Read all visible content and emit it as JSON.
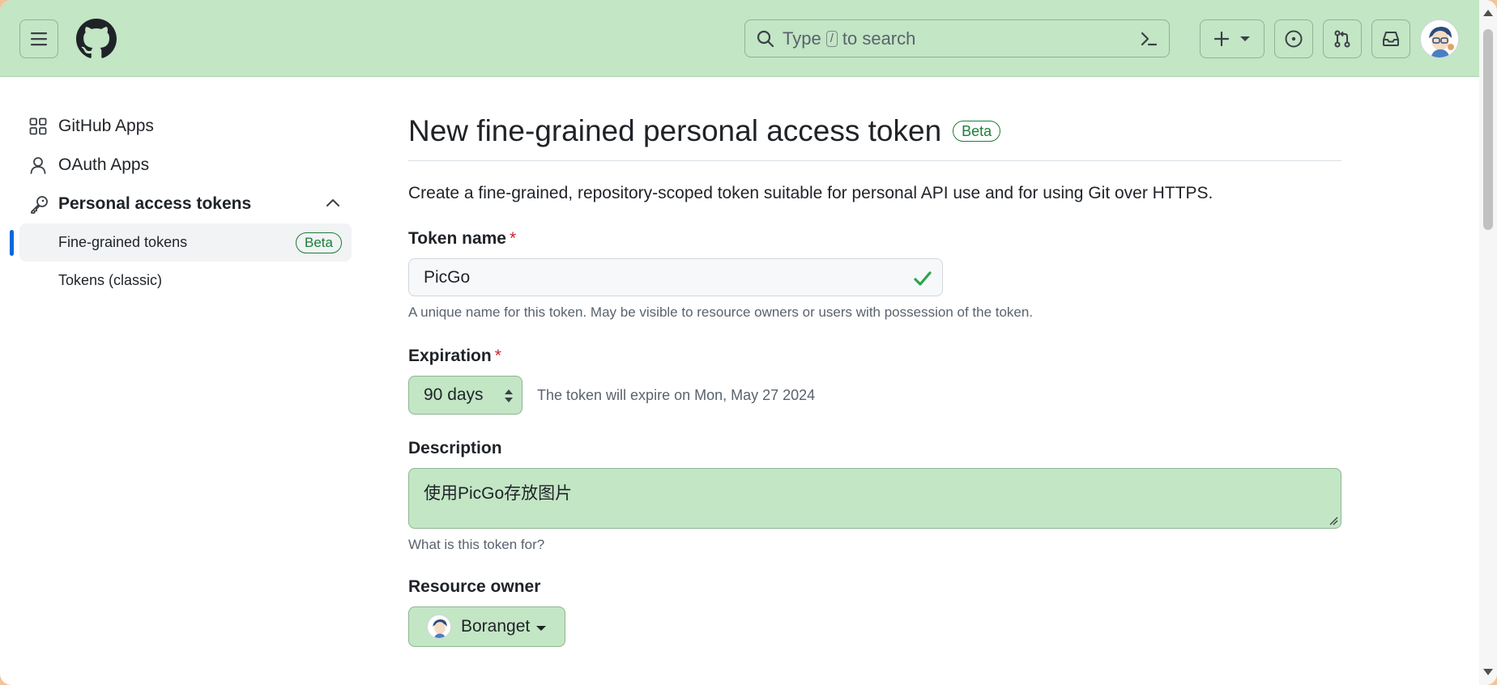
{
  "header": {
    "search_prefix": "Type",
    "search_key": "/",
    "search_suffix": "to search",
    "icons": [
      "menu-icon",
      "github-logo-icon",
      "search-icon",
      "command-palette-icon",
      "plus-icon",
      "chevron-down-icon",
      "issues-icon",
      "pull-request-icon",
      "inbox-icon"
    ]
  },
  "sidebar": {
    "items": [
      {
        "label": "GitHub Apps",
        "icon": "apps-grid-icon"
      },
      {
        "label": "OAuth Apps",
        "icon": "person-icon"
      },
      {
        "label": "Personal access tokens",
        "icon": "key-icon"
      }
    ],
    "sub_items": [
      {
        "label": "Fine-grained tokens",
        "badge": "Beta"
      },
      {
        "label": "Tokens (classic)"
      }
    ]
  },
  "main": {
    "title": "New fine-grained personal access token",
    "title_badge": "Beta",
    "intro": "Create a fine-grained, repository-scoped token suitable for personal API use and for using Git over HTTPS.",
    "token_name": {
      "label": "Token name",
      "required": "*",
      "value": "PicGo",
      "hint": "A unique name for this token. May be visible to resource owners or users with possession of the token."
    },
    "expiration": {
      "label": "Expiration",
      "required": "*",
      "selected": "90 days",
      "note": "The token will expire on Mon, May 27 2024"
    },
    "description": {
      "label": "Description",
      "value": "使用PicGo存放图片",
      "hint": "What is this token for?"
    },
    "resource_owner": {
      "label": "Resource owner",
      "value": "Boranget"
    }
  },
  "colors": {
    "header_bg": "#c3e6c5",
    "accent_blue": "#0969da",
    "success_green": "#1a7f37",
    "required_red": "#cf222e"
  }
}
